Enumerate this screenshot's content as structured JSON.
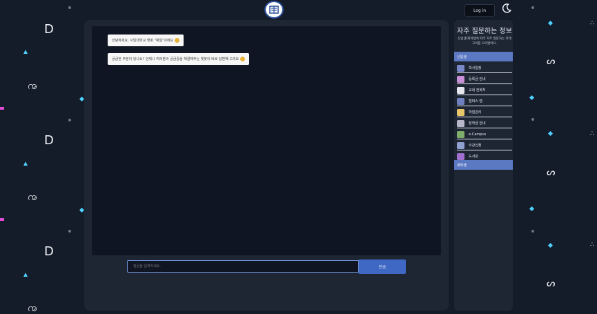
{
  "header": {
    "logo_icon": "university-seal-icon",
    "login_label": "Log in",
    "theme_icon": "moon-icon"
  },
  "chat": {
    "messages": [
      "안녕하세요, 서일대학교 챗봇 \"예일\"이에요",
      "궁금한 부분이 있나요? 언제나 여러분의 궁금증을 해결해주는 챗봇이 바로 답변해 드려요"
    ],
    "input_placeholder": "질문을 입력하세요.",
    "send_label": "전송"
  },
  "faq": {
    "title": "자주 질문하는 정보",
    "description": "신입생/재학생에 따라 자주 질문하는 카테고리를 모아봤어요.",
    "category_new": "신입생",
    "category_current": "재학생",
    "items": [
      {
        "label": "학사일정",
        "icon": "calendar-icon",
        "color": "#7a87c9"
      },
      {
        "label": "등록금 안내",
        "icon": "tuition-icon",
        "color": "#c98fd8"
      },
      {
        "label": "교내 전화처",
        "icon": "phone-icon",
        "color": "#e6e6ee"
      },
      {
        "label": "캠퍼스 맵",
        "icon": "map-icon",
        "color": "#6f7fbf"
      },
      {
        "label": "학점관리",
        "icon": "grade-icon",
        "color": "#e7c66a"
      },
      {
        "label": "장학금 안내",
        "icon": "scholarship-icon",
        "color": "#b7b7c9"
      },
      {
        "label": "e-Campus",
        "icon": "monitor-icon",
        "color": "#7fae6a"
      },
      {
        "label": "수강신청",
        "icon": "registration-icon",
        "color": "#8f9fcf"
      },
      {
        "label": "도서관",
        "icon": "library-icon",
        "color": "#a06fd0"
      }
    ]
  },
  "colors": {
    "background": "#141b29",
    "panel": "#1e2634",
    "chat_area": "#0f1523",
    "accent": "#3f67c4",
    "category": "#5b79c3"
  }
}
